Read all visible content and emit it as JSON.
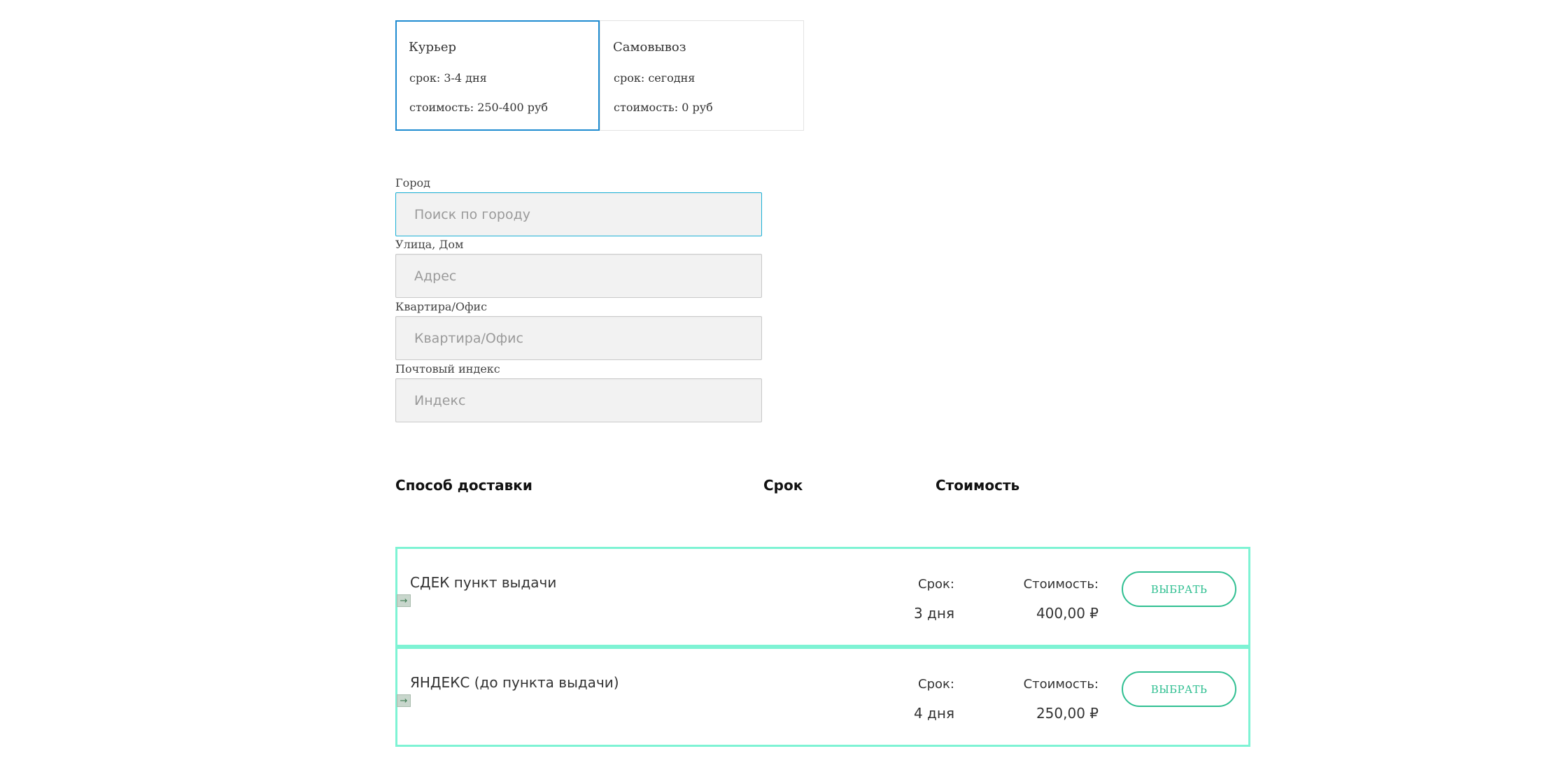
{
  "delivery_types": [
    {
      "title": "Курьер",
      "term": "срок: 3-4 дня",
      "cost": "стоимость: 250-400 руб",
      "selected": true
    },
    {
      "title": "Самовывоз",
      "term": "срок: сегодня",
      "cost": "стоимость: 0 руб",
      "selected": false
    }
  ],
  "form": {
    "city": {
      "label": "Город",
      "placeholder": "Поиск по городу",
      "value": ""
    },
    "street": {
      "label": "Улица, Дом",
      "placeholder": "Адрес",
      "value": ""
    },
    "apartment": {
      "label": "Квартира/Офис",
      "placeholder": "Квартира/Офис",
      "value": ""
    },
    "postal": {
      "label": "Почтовый индекс",
      "placeholder": "Индекс",
      "value": ""
    }
  },
  "table": {
    "headers": {
      "method": "Способ доставки",
      "term": "Срок",
      "cost": "Стоимость"
    },
    "rows": [
      {
        "name": "СДЕК пункт выдачи",
        "term_label": "Срок:",
        "term": "3 дня",
        "cost_label": "Стоимость:",
        "cost": "400,00 ₽",
        "button": "ВЫБРАТЬ"
      },
      {
        "name": "ЯНДЕКС (до пункта выдачи)",
        "term_label": "Срок:",
        "term": "4 дня",
        "cost_label": "Стоимость:",
        "cost": "250,00 ₽",
        "button": "ВЫБРАТЬ"
      }
    ]
  },
  "colors": {
    "selected_border": "#1e8bd0",
    "focus_border": "#1ab0d6",
    "row_border": "#7ef3d4",
    "button_accent": "#2fbf91"
  },
  "icons": {
    "row_icon": "arrow-right-icon"
  }
}
